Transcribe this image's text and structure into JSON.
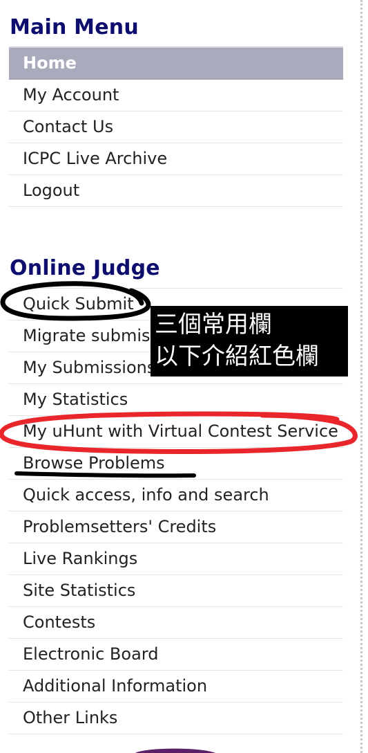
{
  "main_menu": {
    "title": "Main Menu",
    "items": [
      {
        "label": "Home",
        "active": true
      },
      {
        "label": "My Account"
      },
      {
        "label": "Contact Us"
      },
      {
        "label": "ICPC Live Archive"
      },
      {
        "label": "Logout"
      }
    ]
  },
  "online_judge": {
    "title": "Online Judge",
    "items": [
      {
        "label": "Quick Submit"
      },
      {
        "label": "Migrate submissions"
      },
      {
        "label": "My Submissions"
      },
      {
        "label": "My Statistics"
      },
      {
        "label": "My uHunt with Virtual Contest Service"
      },
      {
        "label": "Browse Problems"
      },
      {
        "label": "Quick access, info and search"
      },
      {
        "label": "Problemsetters' Credits"
      },
      {
        "label": "Live Rankings"
      },
      {
        "label": "Site Statistics"
      },
      {
        "label": "Contests"
      },
      {
        "label": "Electronic Board"
      },
      {
        "label": "Additional Information"
      },
      {
        "label": "Other Links"
      }
    ]
  },
  "annotation": {
    "line1": "三個常用欄",
    "line2": "以下介紹紅色欄",
    "colors": {
      "box": "#000000",
      "text": "#ffffff",
      "red_circle": "#e8262b",
      "black_ink": "#000000"
    }
  },
  "colors": {
    "heading": "#0d0d6e",
    "active_bg": "#a9abbd",
    "text": "#222222"
  }
}
